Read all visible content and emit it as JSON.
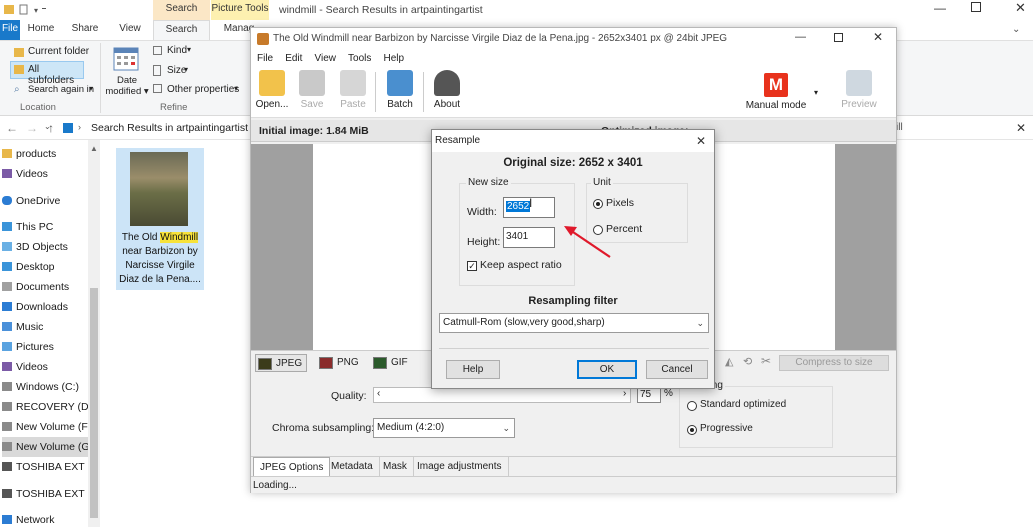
{
  "explorer": {
    "window_title": "windmill - Search Results in artpaintingartist",
    "ribbon_tabs": {
      "file": "File",
      "home": "Home",
      "share": "Share",
      "view": "View",
      "search": "Search",
      "manage": "Manag",
      "search_tools": "Search Tools",
      "picture_tools": "Picture Tools"
    },
    "location_group": {
      "current_folder": "Current folder",
      "all_subfolders": "All subfolders",
      "search_again": "Search again in",
      "label": "Location"
    },
    "refine_group": {
      "date_modified_line1": "Date",
      "date_modified_line2": "modified",
      "kind": "Kind",
      "size": "Size",
      "other_properties": "Other properties",
      "label": "Refine"
    },
    "address_path": "Search Results in artpaintingartist",
    "nav_items": [
      "products",
      "Videos",
      "OneDrive",
      "This PC",
      "3D Objects",
      "Desktop",
      "Documents",
      "Downloads",
      "Music",
      "Pictures",
      "Videos",
      "Windows (C:)",
      "RECOVERY (D:)",
      "New Volume (F:)",
      "New Volume (G:)",
      "TOSHIBA EXT (J:)",
      "TOSHIBA EXT (J:)",
      "Network"
    ],
    "result_file": {
      "line1_pre": "The Old ",
      "line1_hl": "Windmill",
      "line2": "near Barbizon by",
      "line3": "Narcisse Virgile",
      "line4": "Diaz de la Pena...."
    }
  },
  "app": {
    "title": "The Old Windmill near Barbizon by Narcisse Virgile Diaz de la Pena.jpg - 2652x3401 px @ 24bit JPEG",
    "menu": [
      "File",
      "Edit",
      "View",
      "Tools",
      "Help"
    ],
    "toolbar": {
      "open": "Open...",
      "save": "Save",
      "paste": "Paste",
      "batch": "Batch",
      "about": "About",
      "manual_mode": "Manual mode",
      "manual_mode_letter": "M",
      "preview": "Preview"
    },
    "initial_image": "Initial image:  1.84 MiB",
    "optimized_image": "Optimized image:",
    "format_tabs": [
      "JPEG",
      "PNG",
      "GIF"
    ],
    "compress_to_size": "Compress to size",
    "quality_label": "Quality:",
    "quality_value": "75",
    "chroma_label": "Chroma subsampling:",
    "chroma_value": "Medium (4:2:0)",
    "encoding_label": "ding",
    "encoding_options": [
      "Standard optimized",
      "Progressive"
    ],
    "encoding_selected": "Progressive",
    "sub_tabs": [
      "JPEG Options",
      "Metadata",
      "Mask",
      "Image adjustments"
    ],
    "status": "Loading..."
  },
  "dialog": {
    "title": "Resample",
    "original_size": "Original size: 2652 x 3401",
    "new_size_label": "New size",
    "width_label": "Width:",
    "width_value": "2652",
    "height_label": "Height:",
    "height_value": "3401",
    "keep_aspect": "Keep aspect ratio",
    "keep_aspect_checked": true,
    "unit_label": "Unit",
    "unit_pixels": "Pixels",
    "unit_percent": "Percent",
    "unit_selected": "Pixels",
    "filter_label": "Resampling filter",
    "filter_value": "Catmull-Rom (slow,very good,sharp)",
    "help": "Help",
    "ok": "OK",
    "cancel": "Cancel"
  },
  "colors": {
    "accent": "#0078d7",
    "arrow": "#e0192b",
    "manual_mode": "#e8321c",
    "highlight": "#f7e23a",
    "selection": "#cce4f7"
  }
}
